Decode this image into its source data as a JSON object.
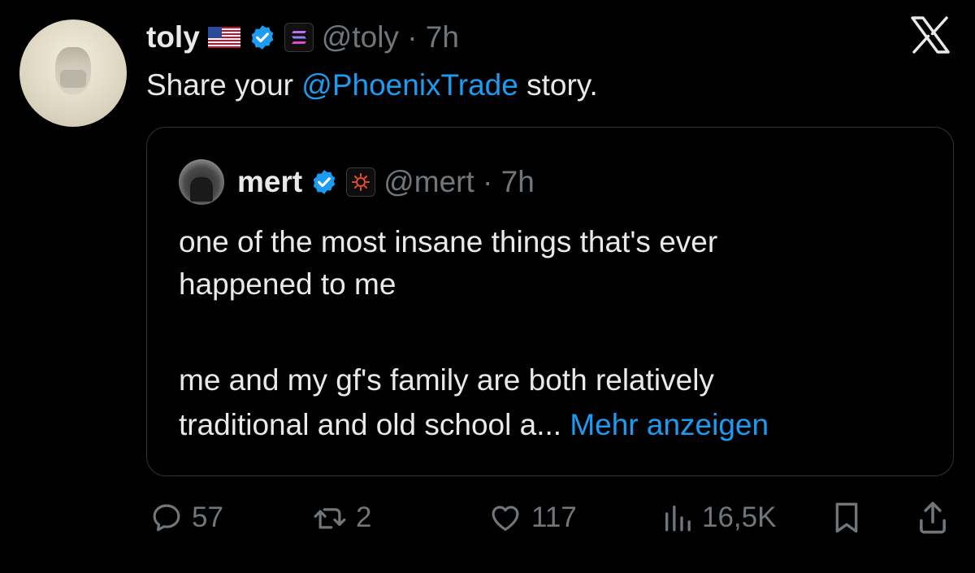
{
  "tweet": {
    "author_name": "toly",
    "handle_time": "@toly · 7h",
    "text_before": "Share your ",
    "mention": "@PhoenixTrade",
    "text_after": " story."
  },
  "quote": {
    "author_name": "mert",
    "handle_time": "@mert · 7h",
    "lines": [
      "one of the most insane things that's ever",
      "happened to me",
      "me and my gf's family are both relatively"
    ],
    "last_line": "traditional and old school a... ",
    "show_more": "Mehr anzeigen"
  },
  "actions": {
    "replies": "57",
    "reposts": "2",
    "likes": "117",
    "views": "16,5K"
  },
  "colors": {
    "background": "#000000",
    "text": "#e7e9ea",
    "muted": "#71767b",
    "accent": "#1d9bf0"
  },
  "icons": [
    "x-logo-icon",
    "us-flag-icon",
    "verified-badge-icon",
    "solana-icon",
    "phoenix-icon",
    "reply-icon",
    "repost-icon",
    "like-icon",
    "views-icon",
    "bookmark-icon",
    "share-icon"
  ]
}
